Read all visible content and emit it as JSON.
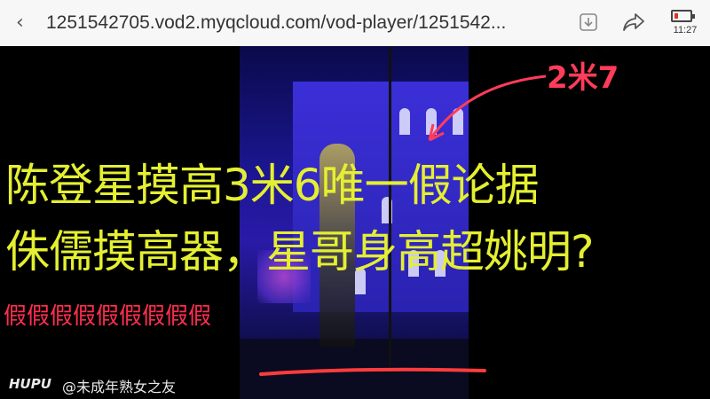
{
  "browser": {
    "url": "1251542705.vod2.myqcloud.com/vod-player/1251542...",
    "time": "11:27",
    "battery_level": 0.25,
    "icons": [
      "back-icon",
      "download-icon",
      "share-icon",
      "battery-icon"
    ]
  },
  "video": {
    "height_annotation": "2米7",
    "title_line1": "陈登星摸高3米6唯一假论据",
    "title_line2": "侏儒摸高器，星哥身高超姚明?",
    "fake_text": "假假假假假假假假假",
    "watermark_logo": "HUPU",
    "watermark_author": "@未成年熟女之友",
    "annotation_color": "#ff3c5a",
    "title_color": "#e4ef31"
  }
}
